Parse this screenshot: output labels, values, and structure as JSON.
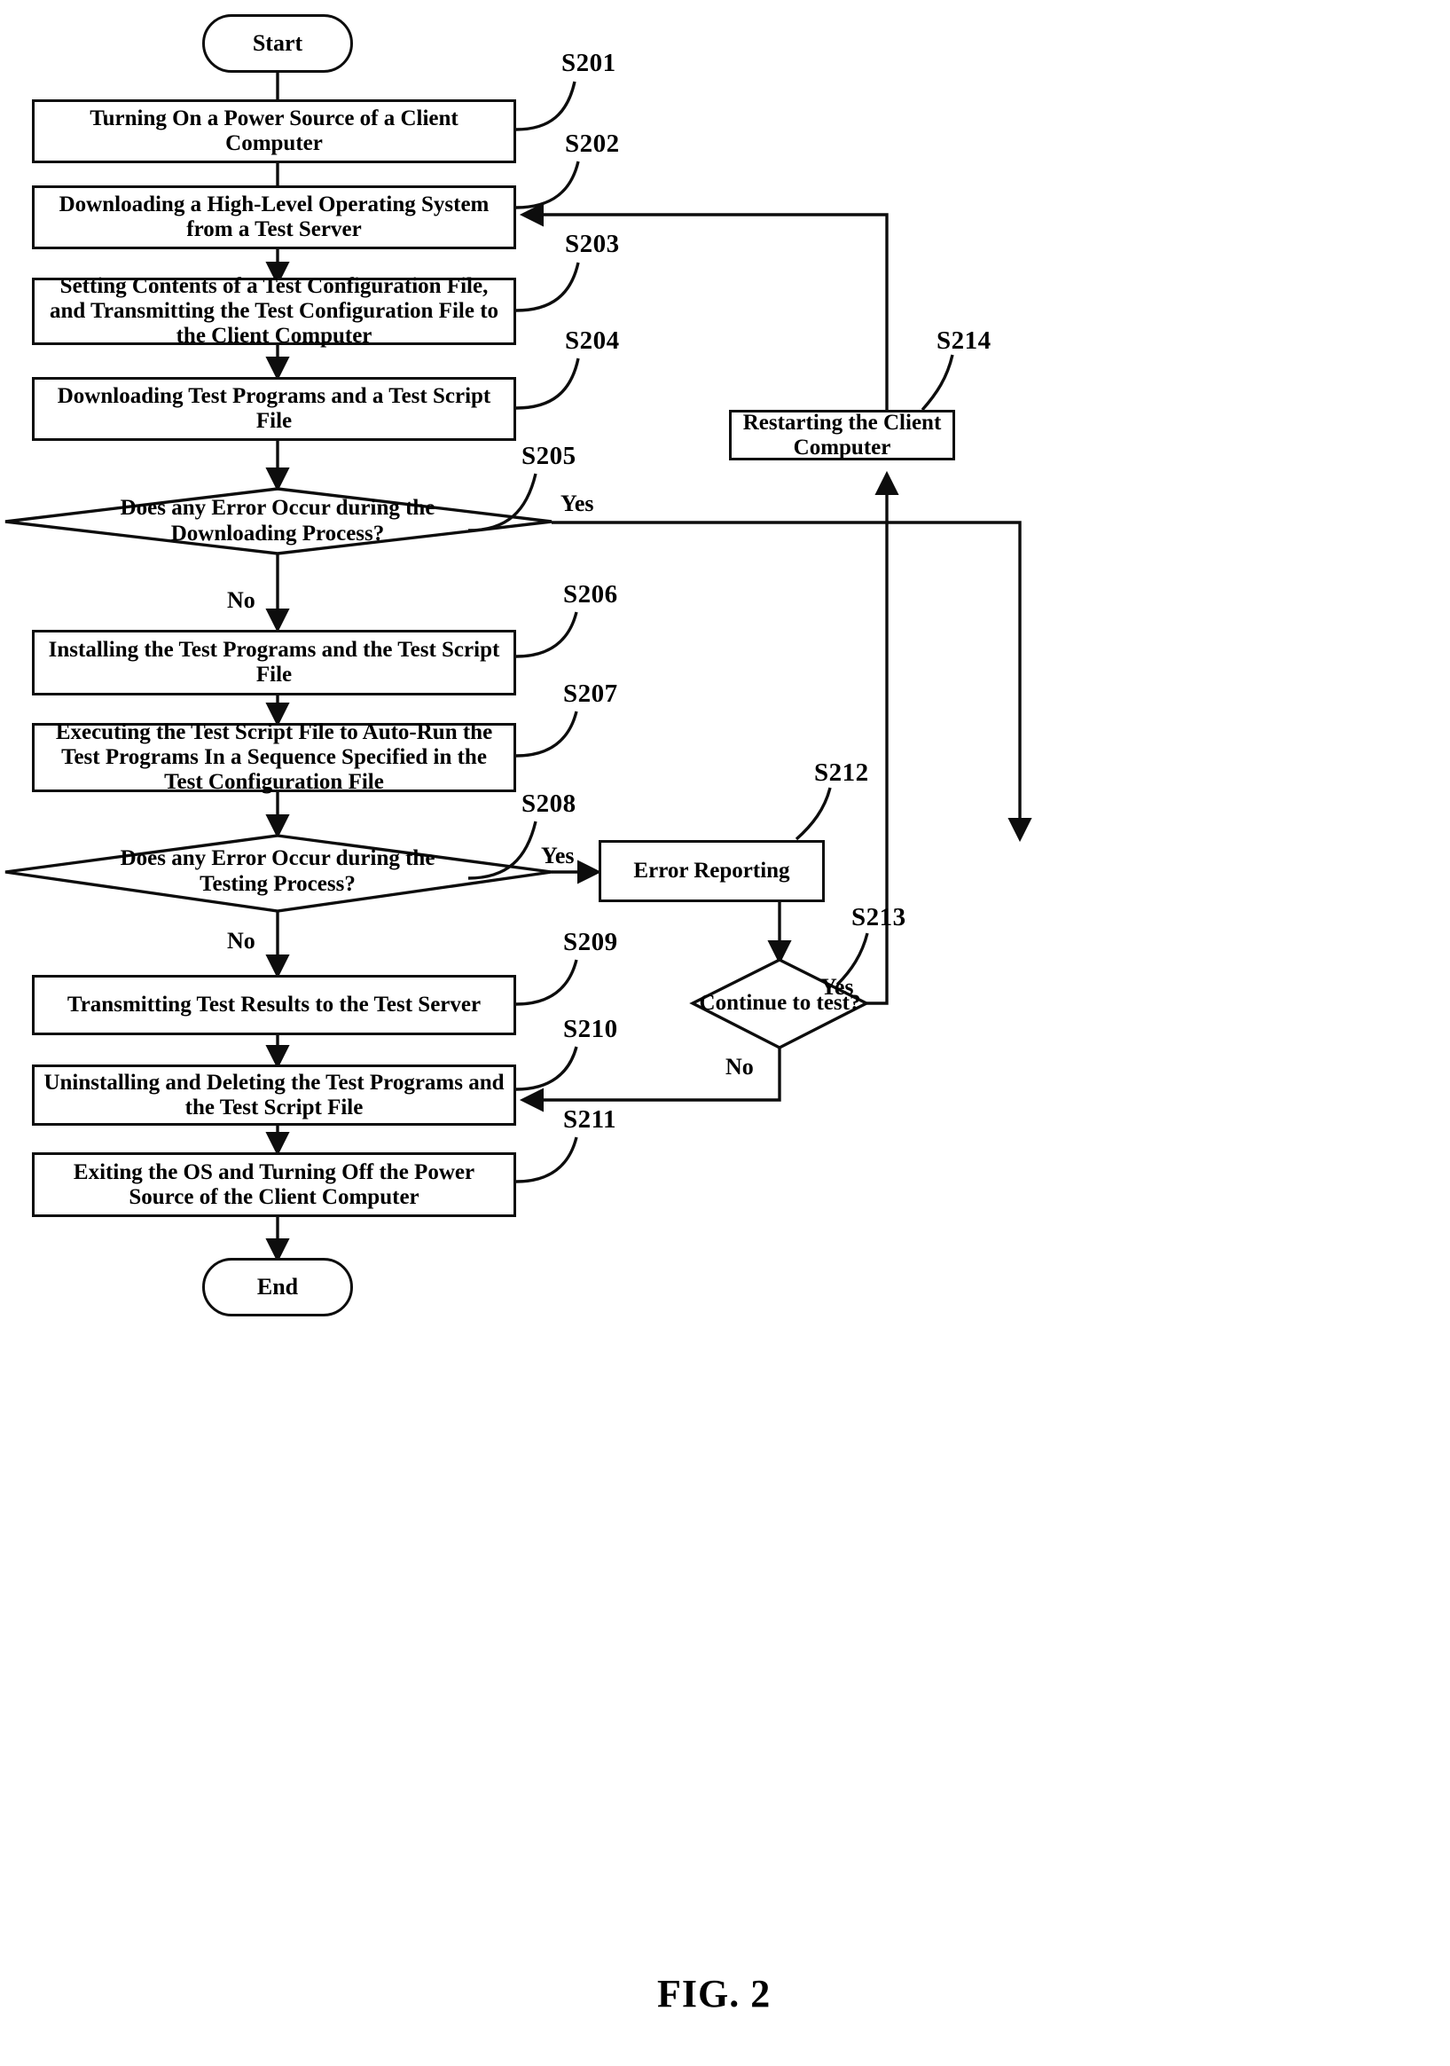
{
  "figure": {
    "caption": "FIG. 2",
    "title": "Flowchart of an automatic client computer test method"
  },
  "terminators": [
    {
      "id": "start",
      "label": "Start"
    },
    {
      "id": "end",
      "label": "End"
    }
  ],
  "nodes": [
    {
      "id": "S201",
      "step": "S201",
      "shape": "process",
      "label": "Turning On a Power Source of a Client Computer"
    },
    {
      "id": "S202",
      "step": "S202",
      "shape": "process",
      "label": "Downloading a High-Level Operating System from a Test Server"
    },
    {
      "id": "S203",
      "step": "S203",
      "shape": "process",
      "label": "Setting Contents of a Test Configuration File, and Transmitting the Test Configuration File to the Client Computer"
    },
    {
      "id": "S204",
      "step": "S204",
      "shape": "process",
      "label": "Downloading Test Programs and a Test Script File"
    },
    {
      "id": "S205",
      "step": "S205",
      "shape": "decision",
      "label": "Does any Error Occur during the Downloading Process?"
    },
    {
      "id": "S206",
      "step": "S206",
      "shape": "process",
      "label": "Installing the Test Programs and the Test Script File"
    },
    {
      "id": "S207",
      "step": "S207",
      "shape": "process",
      "label": "Executing the Test Script File to Auto-Run the Test Programs In a Sequence Specified in the Test Configuration File"
    },
    {
      "id": "S208",
      "step": "S208",
      "shape": "decision",
      "label": "Does any Error Occur during the Testing Process?"
    },
    {
      "id": "S209",
      "step": "S209",
      "shape": "process",
      "label": "Transmitting Test Results to the Test Server"
    },
    {
      "id": "S210",
      "step": "S210",
      "shape": "process",
      "label": "Uninstalling and Deleting the Test Programs and the Test Script File"
    },
    {
      "id": "S211",
      "step": "S211",
      "shape": "process",
      "label": "Exiting the OS and Turning Off the Power Source of the Client Computer"
    },
    {
      "id": "S212",
      "step": "S212",
      "shape": "process",
      "label": "Error Reporting"
    },
    {
      "id": "S213",
      "step": "S213",
      "shape": "decision",
      "label": "Continue to test?"
    },
    {
      "id": "S214",
      "step": "S214",
      "shape": "process",
      "label": "Restarting the Client Computer"
    }
  ],
  "step_labels": [
    {
      "id": "S201",
      "text": "S201"
    },
    {
      "id": "S202",
      "text": "S202"
    },
    {
      "id": "S203",
      "text": "S203"
    },
    {
      "id": "S204",
      "text": "S204"
    },
    {
      "id": "S205",
      "text": "S205"
    },
    {
      "id": "S206",
      "text": "S206"
    },
    {
      "id": "S207",
      "text": "S207"
    },
    {
      "id": "S208",
      "text": "S208"
    },
    {
      "id": "S209",
      "text": "S209"
    },
    {
      "id": "S210",
      "text": "S210"
    },
    {
      "id": "S211",
      "text": "S211"
    },
    {
      "id": "S212",
      "text": "S212"
    },
    {
      "id": "S213",
      "text": "S213"
    },
    {
      "id": "S214",
      "text": "S214"
    }
  ],
  "edge_labels": {
    "s205_yes": "Yes",
    "s205_no": "No",
    "s208_yes": "Yes",
    "s208_no": "No",
    "s213_yes": "Yes",
    "s213_no": "No"
  },
  "edges": [
    {
      "from": "start",
      "to": "S201"
    },
    {
      "from": "S201",
      "to": "S202"
    },
    {
      "from": "S202",
      "to": "S203"
    },
    {
      "from": "S203",
      "to": "S204"
    },
    {
      "from": "S204",
      "to": "S205"
    },
    {
      "from": "S205",
      "to": "S212",
      "label": "Yes"
    },
    {
      "from": "S205",
      "to": "S206",
      "label": "No"
    },
    {
      "from": "S206",
      "to": "S207"
    },
    {
      "from": "S207",
      "to": "S208"
    },
    {
      "from": "S208",
      "to": "S212",
      "label": "Yes"
    },
    {
      "from": "S208",
      "to": "S209",
      "label": "No"
    },
    {
      "from": "S209",
      "to": "S210"
    },
    {
      "from": "S210",
      "to": "S211"
    },
    {
      "from": "S211",
      "to": "end"
    },
    {
      "from": "S212",
      "to": "S213"
    },
    {
      "from": "S213",
      "to": "S214",
      "label": "Yes"
    },
    {
      "from": "S213",
      "to": "S210",
      "label": "No"
    },
    {
      "from": "S214",
      "to": "S202"
    }
  ],
  "colors": {
    "stroke": "#0d0d0d",
    "background": "#ffffff",
    "text": "#000000"
  }
}
